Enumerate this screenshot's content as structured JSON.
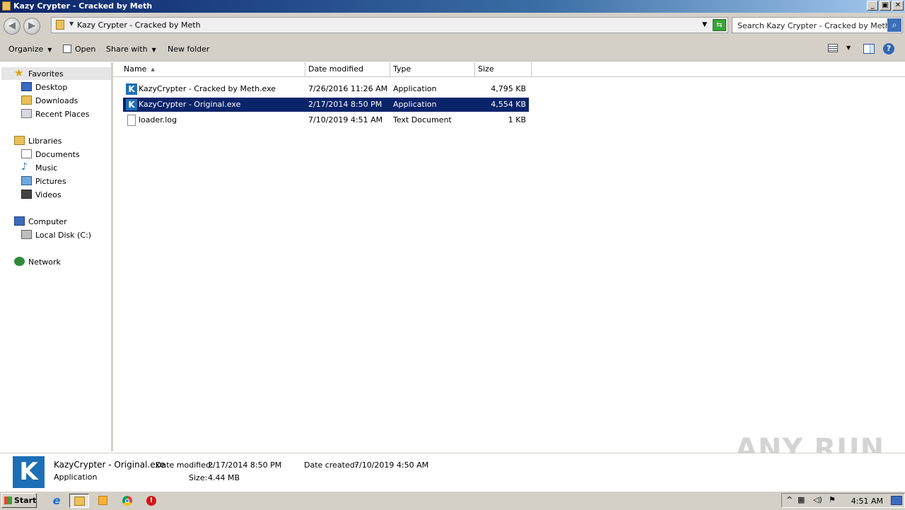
{
  "window": {
    "title": "Kazy Crypter - Cracked by Meth"
  },
  "address": {
    "path": "Kazy Crypter - Cracked by Meth",
    "search_placeholder": "Search Kazy Crypter - Cracked by Meth"
  },
  "toolbar": {
    "organize": "Organize",
    "open": "Open",
    "share_with": "Share with",
    "new_folder": "New folder"
  },
  "nav": {
    "favorites": "Favorites",
    "desktop": "Desktop",
    "downloads": "Downloads",
    "recent_places": "Recent Places",
    "libraries": "Libraries",
    "documents": "Documents",
    "music": "Music",
    "pictures": "Pictures",
    "videos": "Videos",
    "computer": "Computer",
    "local_disk": "Local Disk (C:)",
    "network": "Network"
  },
  "columns": {
    "name": "Name",
    "date_modified": "Date modified",
    "type": "Type",
    "size": "Size"
  },
  "files": [
    {
      "name": "KazyCrypter - Cracked by Meth.exe",
      "date": "7/26/2016 11:26 AM",
      "type": "Application",
      "size": "4,795 KB",
      "icon": "kazycrypter-app-icon",
      "selected": false
    },
    {
      "name": "KazyCrypter - Original.exe",
      "date": "2/17/2014 8:50 PM",
      "type": "Application",
      "size": "4,554 KB",
      "icon": "kazycrypter-app-icon",
      "selected": true
    },
    {
      "name": "loader.log",
      "date": "7/10/2019 4:51 AM",
      "type": "Text Document",
      "size": "1 KB",
      "icon": "text-file-icon",
      "selected": false
    }
  ],
  "details": {
    "name": "KazyCrypter - Original.exe",
    "type": "Application",
    "date_modified_label": "Date modified:",
    "date_modified": "2/17/2014 8:50 PM",
    "date_created_label": "Date created:",
    "date_created": "7/10/2019 4:50 AM",
    "size_label": "Size:",
    "size": "4.44 MB"
  },
  "watermark": "ANY RUN",
  "taskbar": {
    "start": "Start",
    "clock": "4:51 AM"
  }
}
